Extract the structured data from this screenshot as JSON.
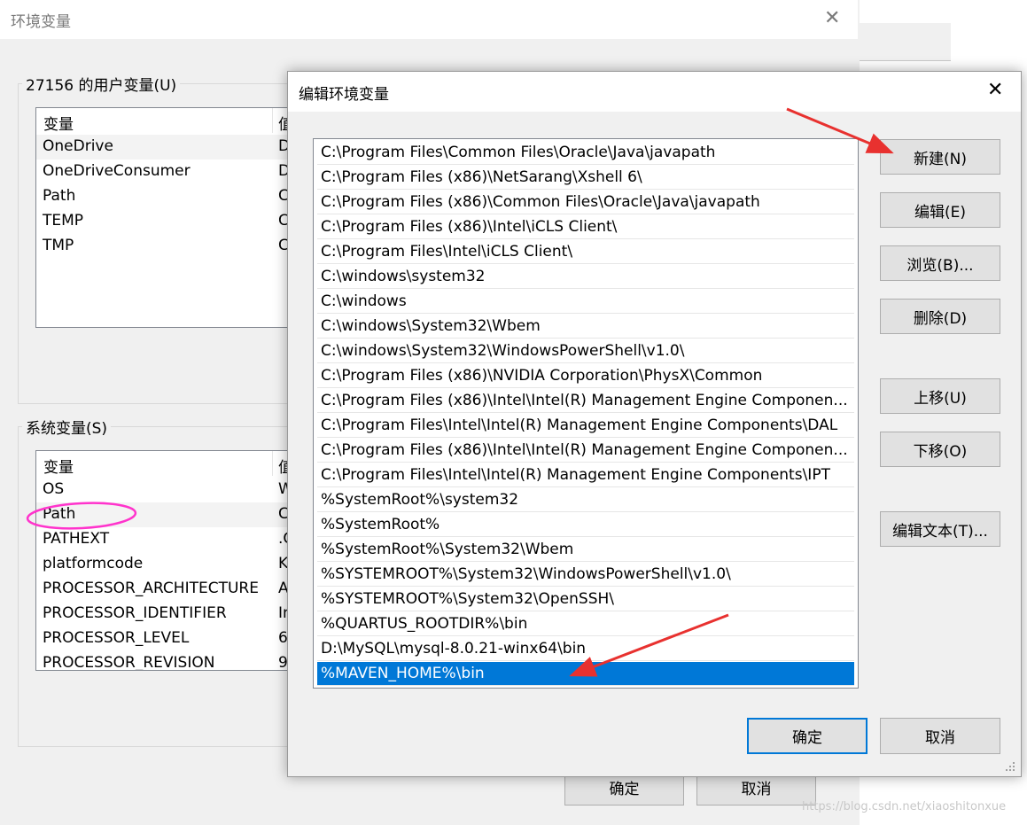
{
  "bg_dialog": {
    "title": "环境变量",
    "close_glyph": "✕",
    "user_vars": {
      "label": "27156 的用户变量(U)",
      "col_var": "变量",
      "col_val": "值",
      "rows": [
        {
          "name": "OneDrive",
          "value": "D"
        },
        {
          "name": "OneDriveConsumer",
          "value": "D"
        },
        {
          "name": "Path",
          "value": "C"
        },
        {
          "name": "TEMP",
          "value": "C"
        },
        {
          "name": "TMP",
          "value": "C"
        }
      ]
    },
    "sys_vars": {
      "label": "系统变量(S)",
      "col_var": "变量",
      "col_val": "值",
      "rows": [
        {
          "name": "OS",
          "value": "W"
        },
        {
          "name": "Path",
          "value": "C"
        },
        {
          "name": "PATHEXT",
          "value": ".C"
        },
        {
          "name": "platformcode",
          "value": "K"
        },
        {
          "name": "PROCESSOR_ARCHITECTURE",
          "value": "A"
        },
        {
          "name": "PROCESSOR_IDENTIFIER",
          "value": "In"
        },
        {
          "name": "PROCESSOR_LEVEL",
          "value": "6"
        },
        {
          "name": "PROCESSOR_REVISION",
          "value": "9"
        }
      ]
    },
    "ok_label": "确定",
    "cancel_label": "取消"
  },
  "edit_dialog": {
    "title": "编辑环境变量",
    "close_glyph": "✕",
    "paths": [
      "C:\\Program Files\\Common Files\\Oracle\\Java\\javapath",
      "C:\\Program Files (x86)\\NetSarang\\Xshell 6\\",
      "C:\\Program Files (x86)\\Common Files\\Oracle\\Java\\javapath",
      "C:\\Program Files (x86)\\Intel\\iCLS Client\\",
      "C:\\Program Files\\Intel\\iCLS Client\\",
      "C:\\windows\\system32",
      "C:\\windows",
      "C:\\windows\\System32\\Wbem",
      "C:\\windows\\System32\\WindowsPowerShell\\v1.0\\",
      "C:\\Program Files (x86)\\NVIDIA Corporation\\PhysX\\Common",
      "C:\\Program Files (x86)\\Intel\\Intel(R) Management Engine Componen...",
      "C:\\Program Files\\Intel\\Intel(R) Management Engine Components\\DAL",
      "C:\\Program Files (x86)\\Intel\\Intel(R) Management Engine Componen...",
      "C:\\Program Files\\Intel\\Intel(R) Management Engine Components\\IPT",
      "%SystemRoot%\\system32",
      "%SystemRoot%",
      "%SystemRoot%\\System32\\Wbem",
      "%SYSTEMROOT%\\System32\\WindowsPowerShell\\v1.0\\",
      "%SYSTEMROOT%\\System32\\OpenSSH\\",
      "%QUARTUS_ROOTDIR%\\bin",
      "D:\\MySQL\\mysql-8.0.21-winx64\\bin",
      "%MAVEN_HOME%\\bin"
    ],
    "selected_index": 21,
    "buttons": {
      "new": "新建(N)",
      "edit": "编辑(E)",
      "browse": "浏览(B)...",
      "delete": "删除(D)",
      "move_up": "上移(U)",
      "move_down": "下移(O)",
      "edit_text": "编辑文本(T)...",
      "ok": "确定",
      "cancel": "取消"
    }
  },
  "annotations": {
    "arrow_color": "#e8312f",
    "circle_color": "#ff33cc"
  },
  "watermark": "https://blog.csdn.net/xiaoshitonxue",
  "colors": {
    "selection": "#0078d7",
    "dialog_bg": "#f0f0f0"
  }
}
